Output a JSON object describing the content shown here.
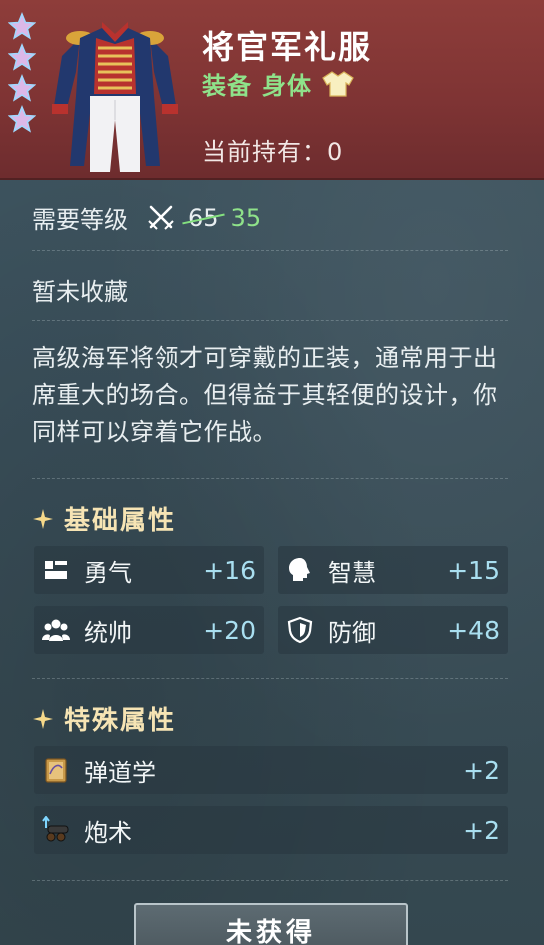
{
  "item": {
    "name": "将官军礼服",
    "type_label": "装备",
    "slot_label": "身体",
    "owned_text": "当前持有：0",
    "rarity_stars": 4
  },
  "requirements": {
    "label": "需要等级",
    "old_level": "65",
    "new_level": "35"
  },
  "collection_status": "暂未收藏",
  "description": "高级海军将领才可穿戴的正装，通常用于出席重大的场合。但得益于其轻便的设计，你同样可以穿着它作战。",
  "basic_attributes": {
    "title": "基础属性",
    "stats": [
      {
        "icon": "courage-icon",
        "name": "勇气",
        "value": "+16"
      },
      {
        "icon": "wisdom-icon",
        "name": "智慧",
        "value": "+15"
      },
      {
        "icon": "command-icon",
        "name": "统帅",
        "value": "+20"
      },
      {
        "icon": "defense-icon",
        "name": "防御",
        "value": "+48"
      }
    ]
  },
  "special_attributes": {
    "title": "特殊属性",
    "stats": [
      {
        "icon": "ballistics-book-icon",
        "name": "弹道学",
        "value": "+2"
      },
      {
        "icon": "cannon-icon",
        "name": "炮术",
        "value": "+2"
      }
    ]
  },
  "action_button": "未获得",
  "colors": {
    "header_red": "#7f3434",
    "green": "#8fe28a",
    "gold": "#f6e4b4",
    "value_blue": "#a9dff0"
  }
}
